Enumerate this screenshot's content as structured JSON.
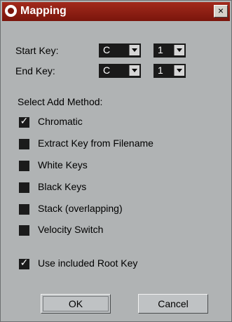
{
  "window": {
    "title": "Mapping",
    "close_glyph": "×",
    "icon": "app-logo-icon"
  },
  "keys": {
    "start_label": "Start Key:",
    "start_note": "C",
    "start_octave": "1",
    "end_label": "End Key:",
    "end_note": "C",
    "end_octave": "1"
  },
  "method": {
    "heading": "Select Add Method:",
    "options": [
      {
        "label": "Chromatic",
        "checked": true
      },
      {
        "label": "Extract Key from Filename",
        "checked": false
      },
      {
        "label": "White Keys",
        "checked": false
      },
      {
        "label": "Black Keys",
        "checked": false
      },
      {
        "label": "Stack (overlapping)",
        "checked": false
      },
      {
        "label": "Velocity Switch",
        "checked": false
      }
    ]
  },
  "root_key": {
    "label": "Use included Root Key",
    "checked": true
  },
  "check_glyph": "✓",
  "buttons": {
    "ok": "OK",
    "cancel": "Cancel"
  },
  "colors": {
    "titlebar": "#7a150c",
    "dialog_bg": "#b0b3b4",
    "control_dark": "#1a1a1a"
  }
}
